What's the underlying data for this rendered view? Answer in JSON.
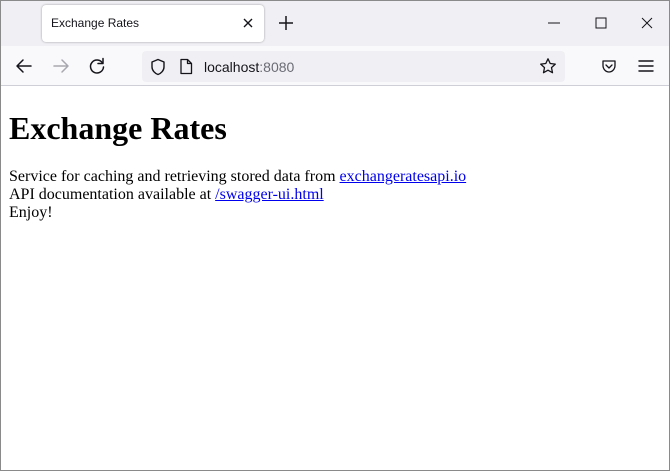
{
  "tab": {
    "title": "Exchange Rates"
  },
  "urlbar": {
    "host": "localhost",
    "port": ":8080"
  },
  "page": {
    "heading": "Exchange Rates",
    "line1_text": "Service for caching and retrieving stored data from ",
    "line1_link": "exchangeratesapi.io",
    "line2_text": "API documentation available at ",
    "line2_link": "/swagger-ui.html",
    "line3_text": "Enjoy!"
  }
}
